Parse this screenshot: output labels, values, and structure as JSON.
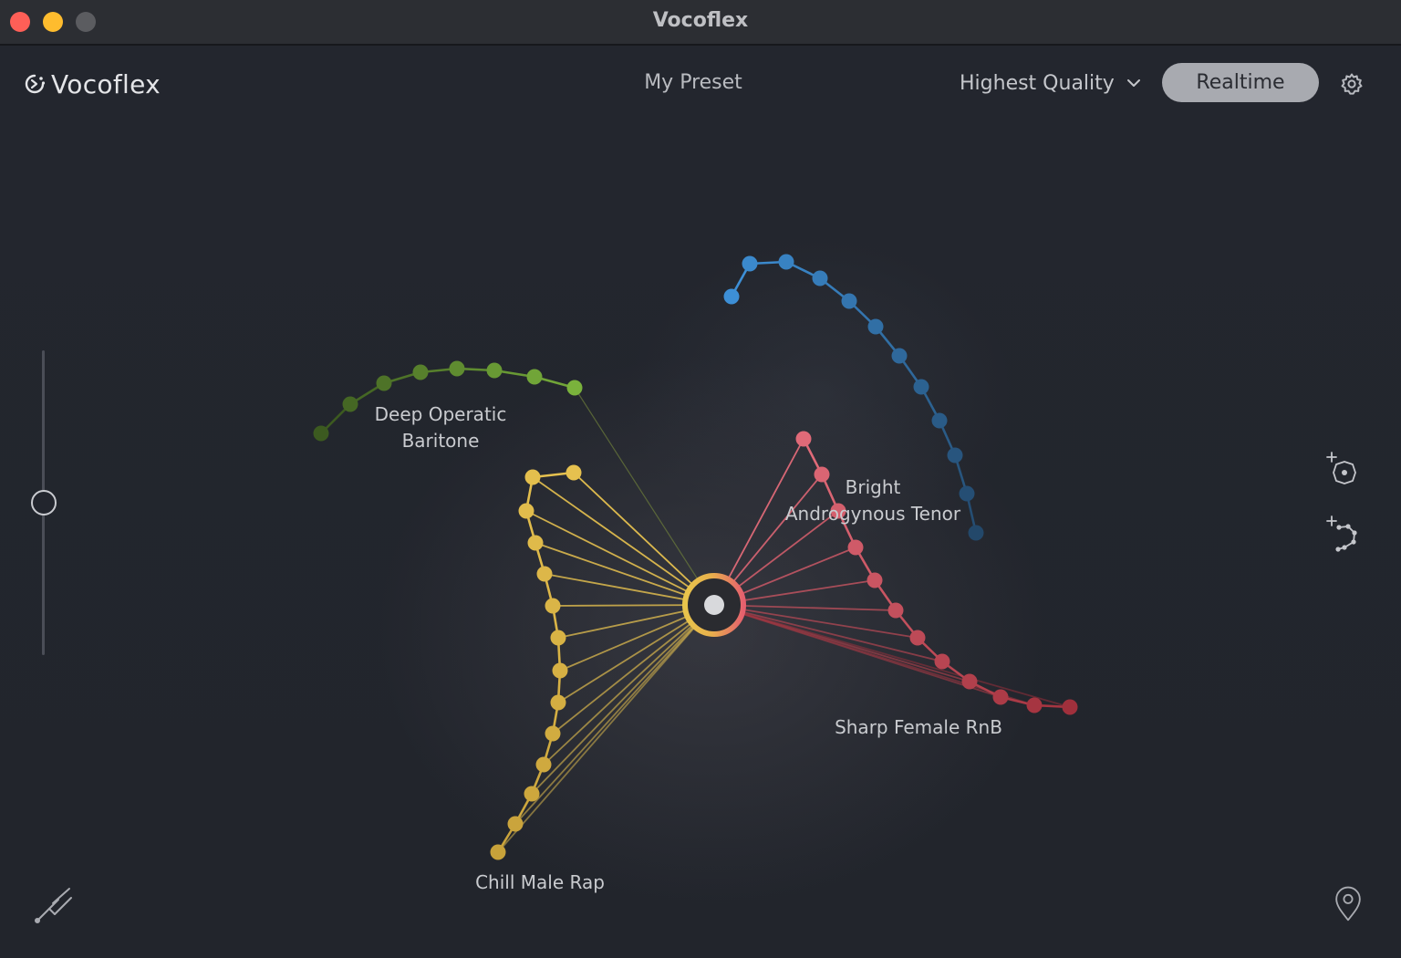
{
  "window": {
    "title": "Vocoflex"
  },
  "header": {
    "app_name": "Vocoflex",
    "preset_name": "My Preset",
    "quality": "Highest Quality",
    "realtime_label": "Realtime"
  },
  "icons": {
    "logo": "vocoflex-logo-icon",
    "settings": "gear-icon",
    "quality_dropdown": "chevron-down-icon",
    "add_voice": "add-voice-icon",
    "add_morph_path": "add-path-icon",
    "tuning_fork": "tuning-fork-icon",
    "location": "map-pin-icon"
  },
  "slider": {
    "value": 0.5
  },
  "voices": [
    {
      "name_lines": [
        "Deep Operatic",
        "Baritone"
      ],
      "color": "#7ab23c",
      "dim_color": "#3c5a20"
    },
    {
      "name_lines": [
        "Bright",
        "Androgynous Tenor"
      ],
      "color": "#3d8fd6",
      "dim_color": "#23486a"
    },
    {
      "name_lines": [
        "Chill Male Rap"
      ],
      "color": "#e6c14f",
      "dim_color": "#c8a23a"
    },
    {
      "name_lines": [
        "Sharp Female RnB"
      ],
      "color": "#e06a78",
      "dim_color": "#a0303c"
    }
  ]
}
